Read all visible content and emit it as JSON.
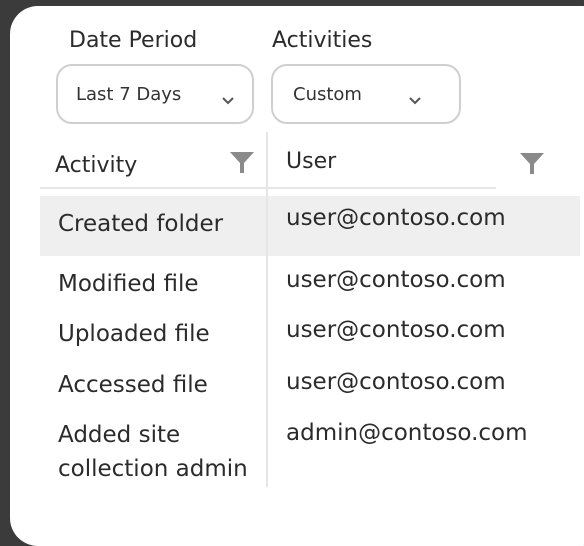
{
  "filters": {
    "date_period": {
      "label": "Date Period",
      "value": "Last 7 Days"
    },
    "activities": {
      "label": "Activities",
      "value": "Custom"
    }
  },
  "table": {
    "columns": [
      {
        "label": "Activity",
        "filter_icon": "funnel-icon"
      },
      {
        "label": "User",
        "filter_icon": "funnel-icon"
      }
    ],
    "rows": [
      {
        "activity": "Created folder",
        "user": "user@contoso.com",
        "selected": true
      },
      {
        "activity": "Modified file",
        "user": "user@contoso.com",
        "selected": false
      },
      {
        "activity": "Uploaded file",
        "user": "user@contoso.com",
        "selected": false
      },
      {
        "activity": "Accessed file",
        "user": "user@contoso.com",
        "selected": false
      },
      {
        "activity_line1": "Added site",
        "activity_line2": "collection admin",
        "user": "admin@contoso.com",
        "selected": false
      }
    ]
  },
  "colors": {
    "background": "#3b3b3b",
    "card": "#ffffff",
    "selected_row": "#efefef",
    "border": "#cfcfcf",
    "icon": "#8a8a8a"
  }
}
